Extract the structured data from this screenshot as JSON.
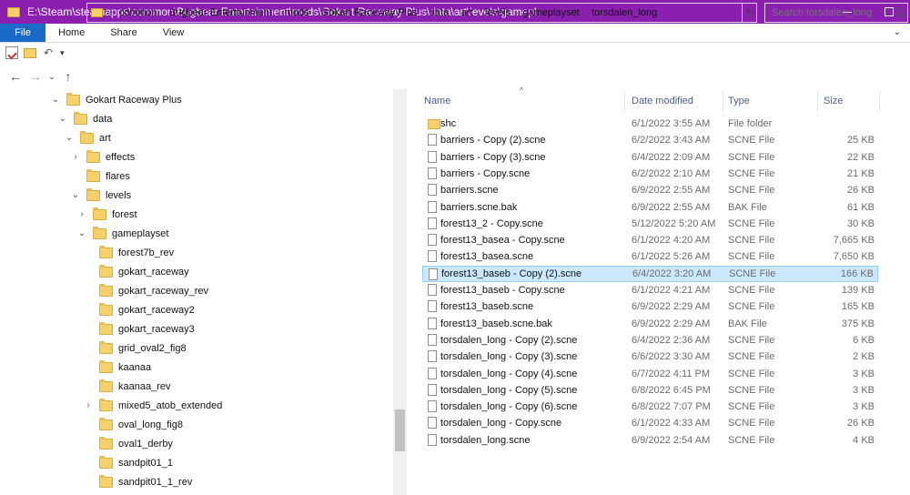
{
  "window": {
    "title": "E:\\Steam\\steamapps\\common\\Bugbear Entertainment\\mods\\Gokart Raceway Plus\\data\\art\\levels\\gamepl",
    "minimize": "—",
    "maximize": "□"
  },
  "ribbon": {
    "tabs": [
      "File",
      "Home",
      "Share",
      "View"
    ]
  },
  "address": {
    "overflow": "«",
    "segments": [
      "common",
      "Bugbear Entertainment",
      "mods",
      "Gokart Raceway Plus",
      "data",
      "art",
      "levels",
      "gameplayset",
      "torsdalen_long"
    ]
  },
  "search": {
    "placeholder": "Search torsdalen_long"
  },
  "tree": [
    {
      "label": "Gokart Raceway Plus",
      "toggle": "expanded"
    },
    {
      "label": "data",
      "toggle": "expanded"
    },
    {
      "label": "art",
      "toggle": "expanded"
    },
    {
      "label": "effects",
      "toggle": "collapsed"
    },
    {
      "label": "flares",
      "toggle": "none"
    },
    {
      "label": "levels",
      "toggle": "expanded"
    },
    {
      "label": "forest",
      "toggle": "collapsed"
    },
    {
      "label": "gameplayset",
      "toggle": "expanded"
    },
    {
      "label": "forest7b_rev",
      "toggle": "none"
    },
    {
      "label": "gokart_raceway",
      "toggle": "none"
    },
    {
      "label": "gokart_raceway_rev",
      "toggle": "none"
    },
    {
      "label": "gokart_raceway2",
      "toggle": "none"
    },
    {
      "label": "gokart_raceway3",
      "toggle": "none"
    },
    {
      "label": "grid_oval2_fig8",
      "toggle": "none"
    },
    {
      "label": "kaanaa",
      "toggle": "none"
    },
    {
      "label": "kaanaa_rev",
      "toggle": "none"
    },
    {
      "label": "mixed5_atob_extended",
      "toggle": "collapsed"
    },
    {
      "label": "oval_long_fig8",
      "toggle": "none"
    },
    {
      "label": "oval1_derby",
      "toggle": "none"
    },
    {
      "label": "sandpit01_1",
      "toggle": "none"
    },
    {
      "label": "sandpit01_1_rev",
      "toggle": "none"
    }
  ],
  "columns": {
    "name": "Name",
    "date": "Date modified",
    "type": "Type",
    "size": "Size"
  },
  "files": [
    {
      "name": "shc",
      "date": "6/1/2022 3:55 AM",
      "type": "File folder",
      "size": "",
      "kind": "folder",
      "selected": false
    },
    {
      "name": "barriers - Copy (2).scne",
      "date": "6/2/2022 3:43 AM",
      "type": "SCNE File",
      "size": "25 KB",
      "kind": "file",
      "selected": false
    },
    {
      "name": "barriers - Copy (3).scne",
      "date": "6/4/2022 2:09 AM",
      "type": "SCNE File",
      "size": "22 KB",
      "kind": "file",
      "selected": false
    },
    {
      "name": "barriers - Copy.scne",
      "date": "6/2/2022 2:10 AM",
      "type": "SCNE File",
      "size": "21 KB",
      "kind": "file",
      "selected": false
    },
    {
      "name": "barriers.scne",
      "date": "6/9/2022 2:55 AM",
      "type": "SCNE File",
      "size": "26 KB",
      "kind": "file",
      "selected": false
    },
    {
      "name": "barriers.scne.bak",
      "date": "6/9/2022 2:55 AM",
      "type": "BAK File",
      "size": "61 KB",
      "kind": "file",
      "selected": false
    },
    {
      "name": "forest13_2 - Copy.scne",
      "date": "5/12/2022 5:20 AM",
      "type": "SCNE File",
      "size": "30 KB",
      "kind": "file",
      "selected": false
    },
    {
      "name": "forest13_basea - Copy.scne",
      "date": "6/1/2022 4:20 AM",
      "type": "SCNE File",
      "size": "7,665 KB",
      "kind": "file",
      "selected": false
    },
    {
      "name": "forest13_basea.scne",
      "date": "6/1/2022 5:26 AM",
      "type": "SCNE File",
      "size": "7,650 KB",
      "kind": "file",
      "selected": false
    },
    {
      "name": "forest13_baseb - Copy (2).scne",
      "date": "6/4/2022 3:20 AM",
      "type": "SCNE File",
      "size": "166 KB",
      "kind": "file",
      "selected": true
    },
    {
      "name": "forest13_baseb - Copy.scne",
      "date": "6/1/2022 4:21 AM",
      "type": "SCNE File",
      "size": "139 KB",
      "kind": "file",
      "selected": false
    },
    {
      "name": "forest13_baseb.scne",
      "date": "6/9/2022 2:29 AM",
      "type": "SCNE File",
      "size": "165 KB",
      "kind": "file",
      "selected": false
    },
    {
      "name": "forest13_baseb.scne.bak",
      "date": "6/9/2022 2:29 AM",
      "type": "BAK File",
      "size": "375 KB",
      "kind": "file",
      "selected": false
    },
    {
      "name": "torsdalen_long - Copy (2).scne",
      "date": "6/4/2022 2:36 AM",
      "type": "SCNE File",
      "size": "6 KB",
      "kind": "file",
      "selected": false
    },
    {
      "name": "torsdalen_long - Copy (3).scne",
      "date": "6/6/2022 3:30 AM",
      "type": "SCNE File",
      "size": "2 KB",
      "kind": "file",
      "selected": false
    },
    {
      "name": "torsdalen_long - Copy (4).scne",
      "date": "6/7/2022 4:11 PM",
      "type": "SCNE File",
      "size": "3 KB",
      "kind": "file",
      "selected": false
    },
    {
      "name": "torsdalen_long - Copy (5).scne",
      "date": "6/8/2022 6:45 PM",
      "type": "SCNE File",
      "size": "3 KB",
      "kind": "file",
      "selected": false
    },
    {
      "name": "torsdalen_long - Copy (6).scne",
      "date": "6/8/2022 7:07 PM",
      "type": "SCNE File",
      "size": "3 KB",
      "kind": "file",
      "selected": false
    },
    {
      "name": "torsdalen_long - Copy.scne",
      "date": "6/1/2022 4:33 AM",
      "type": "SCNE File",
      "size": "26 KB",
      "kind": "file",
      "selected": false
    },
    {
      "name": "torsdalen_long.scne",
      "date": "6/9/2022 2:54 AM",
      "type": "SCNE File",
      "size": "4 KB",
      "kind": "file",
      "selected": false
    }
  ]
}
